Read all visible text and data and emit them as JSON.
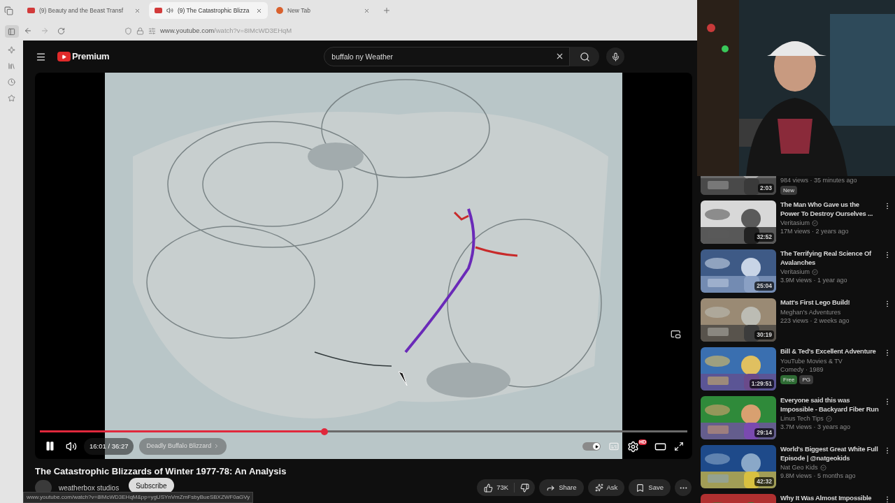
{
  "browser": {
    "tabs": [
      {
        "title": "(9) Beauty and the Beast Transf",
        "selected": false,
        "audio": false,
        "kind": "youtube"
      },
      {
        "title": "(9) The Catastrophic Blizza",
        "selected": true,
        "audio": true,
        "kind": "youtube"
      },
      {
        "title": "New Tab",
        "selected": false,
        "audio": false,
        "kind": "newtab"
      }
    ],
    "url_host": "www.youtube.com",
    "url_path": "/watch?v=8IMcWD3EHqM",
    "status_url": "www.youtube.com/watch?v=8IMcWD3EHqM&pp=ygUSYnVmZmFsbyBueSBXZWF0aGVy"
  },
  "youtube": {
    "logo": "Premium",
    "search": {
      "value": "buffalo ny Weather"
    },
    "player": {
      "level": 0.44,
      "playing": true,
      "autoplay": true,
      "time": "16:01 / 36:27",
      "chapter": "Deadly Buffalo Blizzard",
      "quality_badge": "HD"
    },
    "video_title": "The Catastrophic Blizzards of Winter 1977-78: An Analysis",
    "channel": "weatherbox studios",
    "subscribe": "Subscribe",
    "actions": {
      "likes": "73K",
      "share": "Share",
      "ask": "Ask",
      "save": "Save"
    },
    "recommendations": [
      {
        "duration": "2:03",
        "meta": [
          "984 views · 35 minutes ago"
        ],
        "badges": [
          {
            "label": "New",
            "color": "#3a3a3a"
          }
        ]
      },
      {
        "duration": "32:52",
        "title": "The Man Who Gave us the Power To Destroy Ourselves ...",
        "channel": "Veritasium",
        "verified": true,
        "meta": [
          "17M views · 2 years ago"
        ]
      },
      {
        "duration": "25:04",
        "title": "The Terrifying Real Science Of Avalanches",
        "channel": "Veritasium",
        "verified": true,
        "meta": [
          "3.9M views · 1 year ago"
        ]
      },
      {
        "duration": "30:19",
        "title": "Matt's First Lego Build!",
        "channel": "Meghan's Adventures",
        "verified": false,
        "meta": [
          "223 views · 2 weeks ago"
        ]
      },
      {
        "duration": "1:29:51",
        "title": "Bill & Ted's Excellent Adventure",
        "channel": "YouTube Movies & TV",
        "verified": false,
        "meta": [
          "Comedy · 1989"
        ],
        "badges": [
          {
            "label": "Free",
            "color": "#2e6b34"
          },
          {
            "label": "PG",
            "color": "#3a3a3a"
          }
        ]
      },
      {
        "duration": "29:14",
        "title": "Everyone said this was Impossible - Backyard Fiber Run",
        "channel": "Linus Tech Tips",
        "verified": true,
        "meta": [
          "3.7M views · 3 years ago"
        ]
      },
      {
        "duration": "42:32",
        "title": "World's Biggest Great White Full Episode | @natgeokids",
        "channel": "Nat Geo Kids",
        "verified": true,
        "meta": [
          "9.8M views · 5 months ago"
        ]
      },
      {
        "title": "Why It Was Almost Impossible"
      }
    ]
  }
}
